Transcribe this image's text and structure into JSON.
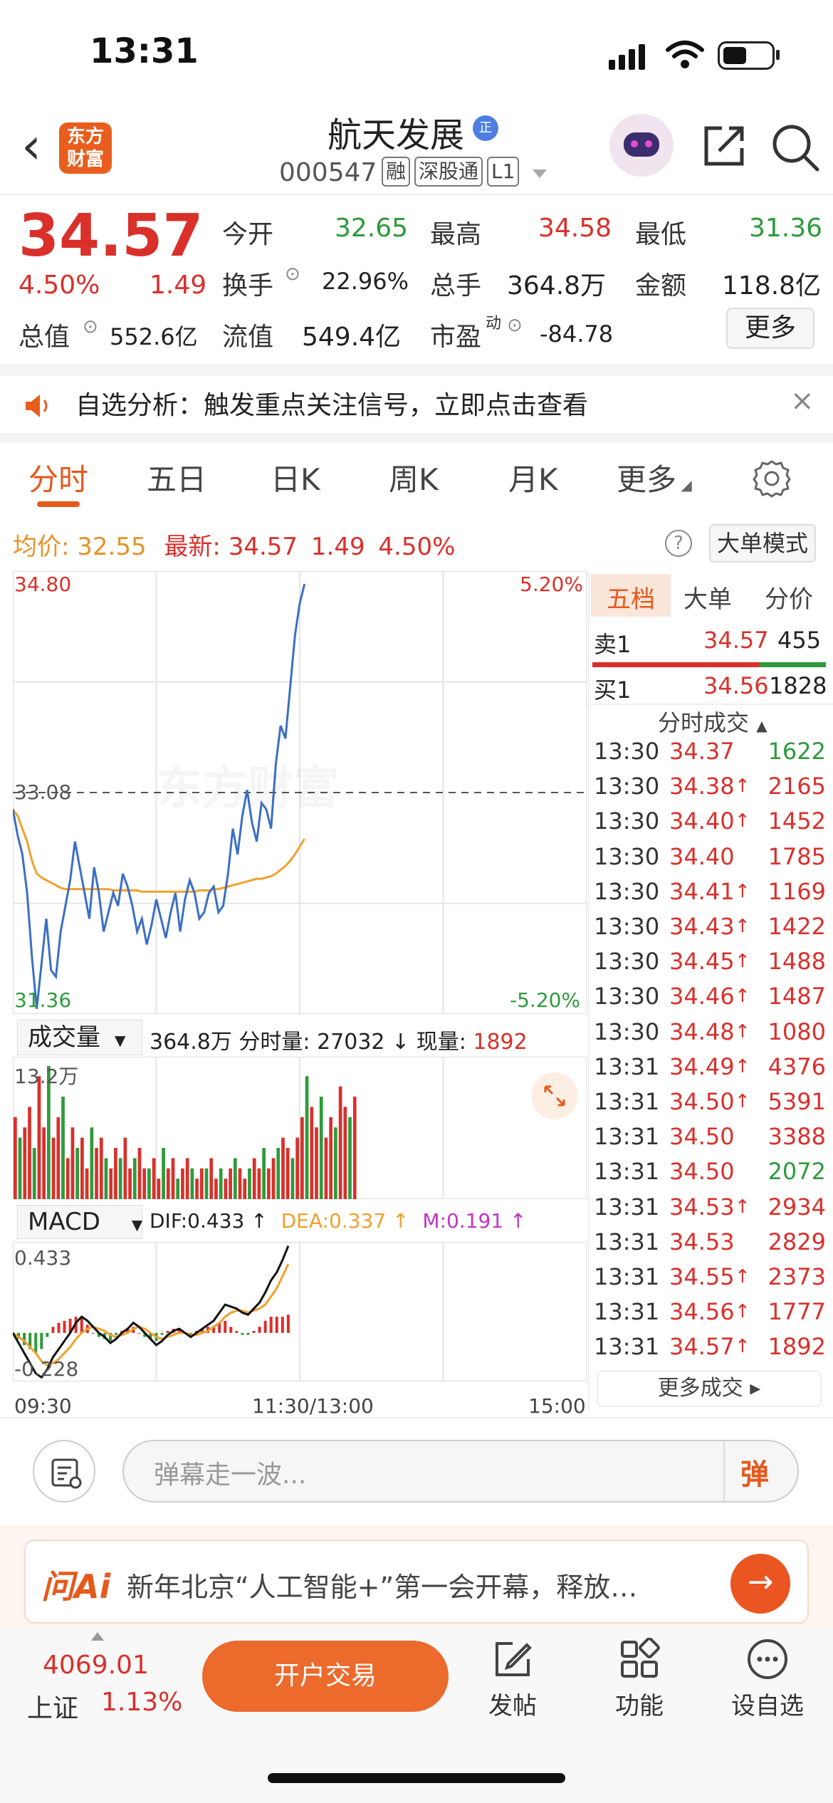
{
  "status_bar": {
    "time": "13:31"
  },
  "header": {
    "logo_text": "东方财富",
    "stock_name": "航天发展",
    "name_badge": "正",
    "stock_code": "000547",
    "tags": [
      "融",
      "深股通",
      "L1"
    ]
  },
  "quote": {
    "price": "34.57",
    "change_pct": "4.50%",
    "change": "1.49",
    "open_label": "今开",
    "open": "32.65",
    "high_label": "最高",
    "high": "34.58",
    "low_label": "最低",
    "low": "31.36",
    "turnover_label": "换手",
    "turnover": "22.96%",
    "volume_label": "总手",
    "volume": "364.8万",
    "amount_label": "金额",
    "amount": "118.8亿",
    "mktcap_label": "总值",
    "mktcap": "552.6亿",
    "float_label": "流值",
    "float": "549.4亿",
    "pe_label": "市盈",
    "pe_sup": "动",
    "pe": "-84.78",
    "more_label": "更多"
  },
  "notice": {
    "text": "自选分析：触发重点关注信号，立即点击查看"
  },
  "tabs": [
    "分时",
    "五日",
    "日K",
    "周K",
    "月K",
    "更多"
  ],
  "avg_row": {
    "avg_label": "均价:",
    "avg": "32.55",
    "latest_label": "最新:",
    "latest": "34.57",
    "chg": "1.49",
    "pct": "4.50%",
    "mode_btn": "大单模式"
  },
  "intraday": {
    "y_max": "34.80",
    "y_min": "31.36",
    "y_mid": "33.08",
    "pct_max": "5.20%",
    "pct_min": "-5.20%",
    "watermark": "东方财富",
    "price_series": [
      32.95,
      32.75,
      32.6,
      32.3,
      31.8,
      31.4,
      31.75,
      32.1,
      31.7,
      31.65,
      32.0,
      32.2,
      32.4,
      32.7,
      32.5,
      32.3,
      32.1,
      32.5,
      32.3,
      32.0,
      32.15,
      32.3,
      32.2,
      32.45,
      32.35,
      32.2,
      32.0,
      32.1,
      31.9,
      32.05,
      32.25,
      32.1,
      31.95,
      32.15,
      32.3,
      32.0,
      32.25,
      32.4,
      32.3,
      32.1,
      32.15,
      32.3,
      32.35,
      32.15,
      32.2,
      32.45,
      32.8,
      32.6,
      32.9,
      33.1,
      32.85,
      32.7,
      33.0,
      32.95,
      32.8,
      33.3,
      33.6,
      33.5,
      33.9,
      34.3,
      34.55,
      34.7
    ],
    "avg_series": [
      32.95,
      32.9,
      32.8,
      32.7,
      32.55,
      32.45,
      32.42,
      32.4,
      32.38,
      32.36,
      32.34,
      32.33,
      32.33,
      32.33,
      32.33,
      32.33,
      32.33,
      32.33,
      32.33,
      32.33,
      32.33,
      32.32,
      32.32,
      32.32,
      32.32,
      32.32,
      32.32,
      32.31,
      32.31,
      32.31,
      32.31,
      32.31,
      32.31,
      32.31,
      32.31,
      32.31,
      32.31,
      32.31,
      32.31,
      32.32,
      32.32,
      32.32,
      32.33,
      32.33,
      32.34,
      32.35,
      32.36,
      32.37,
      32.38,
      32.39,
      32.4,
      32.41,
      32.41,
      32.42,
      32.43,
      32.45,
      32.48,
      32.51,
      32.55,
      32.6,
      32.66,
      32.72
    ]
  },
  "volume": {
    "label": "成交量",
    "info": "364.8万 分时量: 27032 ↓ 现量:",
    "now_vol": "1892",
    "y_max": "13.2万",
    "bars": [
      8,
      6,
      7,
      9,
      5,
      12,
      7,
      13,
      6,
      8,
      10,
      4,
      7,
      5,
      6,
      3,
      7,
      5,
      6,
      4,
      3,
      5,
      4,
      6,
      3,
      4,
      5,
      3,
      3,
      4,
      2,
      5,
      3,
      4,
      2,
      3,
      4,
      3,
      2,
      3,
      3,
      4,
      2,
      3,
      2,
      3,
      4,
      3,
      2,
      3,
      4,
      3,
      5,
      3,
      4,
      5,
      6,
      5,
      4,
      6,
      8,
      12,
      9,
      7,
      10,
      6,
      8,
      7,
      11,
      9,
      8,
      10
    ],
    "bar_colors": "rgmix"
  },
  "macd": {
    "label": "MACD",
    "dif": "DIF:0.433 ↑",
    "dea": "DEA:0.337 ↑",
    "m": "M:0.191 ↑",
    "y_max": "0.433",
    "y_min": "-0.228",
    "dif_series": [
      0.0,
      -0.05,
      -0.1,
      -0.15,
      -0.2,
      -0.22,
      -0.18,
      -0.12,
      -0.08,
      -0.04,
      0.0,
      0.05,
      0.08,
      0.06,
      0.03,
      0.0,
      -0.02,
      -0.05,
      -0.03,
      0.0,
      0.02,
      0.05,
      0.03,
      0.0,
      -0.03,
      -0.06,
      -0.04,
      -0.01,
      0.01,
      0.02,
      0.0,
      -0.02,
      0.0,
      0.02,
      0.04,
      0.06,
      0.1,
      0.14,
      0.13,
      0.12,
      0.1,
      0.09,
      0.12,
      0.15,
      0.2,
      0.26,
      0.3,
      0.36,
      0.43
    ],
    "dea_series": [
      0.0,
      -0.02,
      -0.04,
      -0.07,
      -0.1,
      -0.14,
      -0.16,
      -0.15,
      -0.13,
      -0.1,
      -0.07,
      -0.03,
      0.0,
      0.02,
      0.03,
      0.02,
      0.01,
      -0.01,
      -0.02,
      -0.01,
      0.0,
      0.02,
      0.03,
      0.02,
      0.0,
      -0.02,
      -0.03,
      -0.02,
      -0.01,
      0.0,
      0.0,
      -0.01,
      -0.01,
      0.0,
      0.01,
      0.03,
      0.05,
      0.08,
      0.1,
      0.11,
      0.11,
      0.1,
      0.11,
      0.12,
      0.14,
      0.18,
      0.22,
      0.28,
      0.34
    ],
    "hist": [
      0.0,
      -0.03,
      -0.06,
      -0.08,
      -0.1,
      -0.08,
      -0.02,
      0.03,
      0.05,
      0.06,
      0.07,
      0.08,
      0.08,
      0.04,
      0.0,
      -0.02,
      -0.03,
      -0.04,
      -0.01,
      0.01,
      0.02,
      0.03,
      0.0,
      -0.02,
      -0.03,
      -0.04,
      -0.01,
      0.01,
      0.02,
      0.02,
      0.0,
      -0.01,
      0.01,
      0.02,
      0.03,
      0.03,
      0.05,
      0.06,
      0.03,
      0.01,
      -0.01,
      -0.01,
      0.01,
      0.03,
      0.06,
      0.08,
      0.08,
      0.08,
      0.09
    ]
  },
  "time_axis": [
    "09:30",
    "11:30/13:00",
    "15:00"
  ],
  "right_panel": {
    "tabs": [
      "五档",
      "大单",
      "分价"
    ],
    "sell1": {
      "label": "卖1",
      "price": "34.57",
      "vol": "455"
    },
    "buy1": {
      "label": "买1",
      "price": "34.56",
      "vol": "1828"
    },
    "trades_title": "分时成交",
    "trades": [
      {
        "t": "13:30",
        "p": "34.37",
        "up": "",
        "v": "1622",
        "c": "green"
      },
      {
        "t": "13:30",
        "p": "34.38",
        "up": "↑",
        "v": "2165",
        "c": "red"
      },
      {
        "t": "13:30",
        "p": "34.40",
        "up": "↑",
        "v": "1452",
        "c": "red"
      },
      {
        "t": "13:30",
        "p": "34.40",
        "up": "",
        "v": "1785",
        "c": "red"
      },
      {
        "t": "13:30",
        "p": "34.41",
        "up": "↑",
        "v": "1169",
        "c": "red"
      },
      {
        "t": "13:30",
        "p": "34.43",
        "up": "↑",
        "v": "1422",
        "c": "red"
      },
      {
        "t": "13:30",
        "p": "34.45",
        "up": "↑",
        "v": "1488",
        "c": "red"
      },
      {
        "t": "13:30",
        "p": "34.46",
        "up": "↑",
        "v": "1487",
        "c": "red"
      },
      {
        "t": "13:30",
        "p": "34.48",
        "up": "↑",
        "v": "1080",
        "c": "red"
      },
      {
        "t": "13:31",
        "p": "34.49",
        "up": "↑",
        "v": "4376",
        "c": "red"
      },
      {
        "t": "13:31",
        "p": "34.50",
        "up": "↑",
        "v": "5391",
        "c": "red"
      },
      {
        "t": "13:31",
        "p": "34.50",
        "up": "",
        "v": "3388",
        "c": "red"
      },
      {
        "t": "13:31",
        "p": "34.50",
        "up": "",
        "v": "2072",
        "c": "green"
      },
      {
        "t": "13:31",
        "p": "34.53",
        "up": "↑",
        "v": "2934",
        "c": "red"
      },
      {
        "t": "13:31",
        "p": "34.53",
        "up": "",
        "v": "2829",
        "c": "red"
      },
      {
        "t": "13:31",
        "p": "34.55",
        "up": "↑",
        "v": "2373",
        "c": "red"
      },
      {
        "t": "13:31",
        "p": "34.56",
        "up": "↑",
        "v": "1777",
        "c": "red"
      },
      {
        "t": "13:31",
        "p": "34.57",
        "up": "↑",
        "v": "1892",
        "c": "red"
      }
    ],
    "more_trades": "更多成交 ▸"
  },
  "danmaku": {
    "placeholder": "弹幕走一波...",
    "btn": "弹"
  },
  "ai_banner": {
    "logo": "问Ai",
    "text": "新年北京“人工智能+”第一会开幕，释放…"
  },
  "bottom": {
    "index_value": "4069.01",
    "index_name": "上证",
    "index_pct": "1.13%",
    "trade_btn": "开户交易",
    "nav": [
      "发帖",
      "功能",
      "设自选"
    ]
  },
  "colors": {
    "accent": "#e45a1d",
    "up": "#d9302b",
    "down": "#2e9a3c",
    "price_line": "#3b6fc4",
    "avg_line": "#f0a030"
  }
}
